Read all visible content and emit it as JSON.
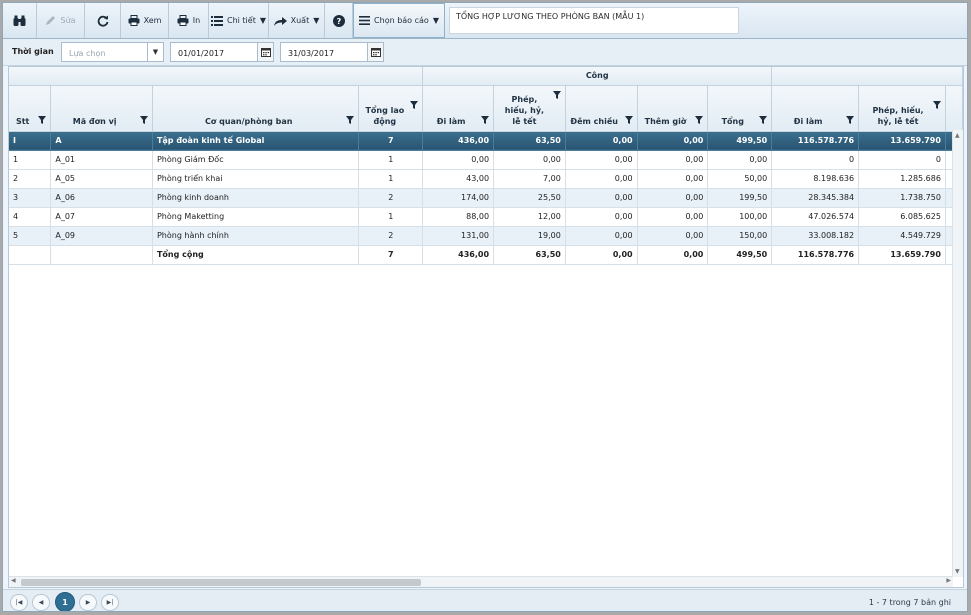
{
  "toolbar": {
    "edit_label": "Sửa",
    "view_label": "Xem",
    "print_label": "In",
    "detail_label": "Chi tiết",
    "export_label": "Xuất",
    "choose_report_label": "Chọn báo cáo",
    "report_title": "TỔNG HỢP LƯƠNG THEO PHÒNG BAN (MẪU 1)"
  },
  "filter": {
    "label": "Thời gian",
    "period_placeholder": "Lựa chọn",
    "from_date": "01/01/2017",
    "to_date": "31/03/2017"
  },
  "table": {
    "group_cong": "Công",
    "group_luong": "",
    "headers": {
      "stt": "Stt",
      "ma_don_vi": "Mã đơn vị",
      "co_quan": "Cơ quan/phòng ban",
      "tong_lao_dong": "Tổng lao động",
      "di_lam": "Đi làm",
      "phep": "Phép, hiếu, hỷ, lễ tết",
      "dem_chieu": "Đêm chiều",
      "them_gio": "Thêm giờ",
      "tong": "Tổng",
      "luong_di_lam": "Đi làm",
      "luong_phep": "Phép, hiếu, hỷ, lễ tết"
    },
    "rows": [
      {
        "stt": "I",
        "ma": "A",
        "ten": "Tập đoàn kinh tế Global",
        "tld": "7",
        "dilam": "436,00",
        "phep": "63,50",
        "dem": "0,00",
        "them": "0,00",
        "tong": "499,50",
        "l_dilam": "116.578.776",
        "l_phep": "13.659.790",
        "kind": "sel"
      },
      {
        "stt": "1",
        "ma": "A_01",
        "ten": "Phòng Giám Đốc",
        "tld": "1",
        "dilam": "0,00",
        "phep": "0,00",
        "dem": "0,00",
        "them": "0,00",
        "tong": "0,00",
        "l_dilam": "0",
        "l_phep": "0",
        "kind": ""
      },
      {
        "stt": "2",
        "ma": "A_05",
        "ten": "Phòng triển khai",
        "tld": "1",
        "dilam": "43,00",
        "phep": "7,00",
        "dem": "0,00",
        "them": "0,00",
        "tong": "50,00",
        "l_dilam": "8.198.636",
        "l_phep": "1.285.686",
        "kind": ""
      },
      {
        "stt": "3",
        "ma": "A_06",
        "ten": "Phòng kinh doanh",
        "tld": "2",
        "dilam": "174,00",
        "phep": "25,50",
        "dem": "0,00",
        "them": "0,00",
        "tong": "199,50",
        "l_dilam": "28.345.384",
        "l_phep": "1.738.750",
        "kind": "alt"
      },
      {
        "stt": "4",
        "ma": "A_07",
        "ten": "Phòng Maketting",
        "tld": "1",
        "dilam": "88,00",
        "phep": "12,00",
        "dem": "0,00",
        "them": "0,00",
        "tong": "100,00",
        "l_dilam": "47.026.574",
        "l_phep": "6.085.625",
        "kind": ""
      },
      {
        "stt": "5",
        "ma": "A_09",
        "ten": "Phòng hành chính",
        "tld": "2",
        "dilam": "131,00",
        "phep": "19,00",
        "dem": "0,00",
        "them": "0,00",
        "tong": "150,00",
        "l_dilam": "33.008.182",
        "l_phep": "4.549.729",
        "kind": "alt"
      },
      {
        "stt": "",
        "ma": "",
        "ten": "Tổng cộng",
        "tld": "7",
        "dilam": "436,00",
        "phep": "63,50",
        "dem": "0,00",
        "them": "0,00",
        "tong": "499,50",
        "l_dilam": "116.578.776",
        "l_phep": "13.659.790",
        "kind": "total"
      }
    ]
  },
  "pager": {
    "current_page": "1",
    "info": "1 - 7 trong 7 bản ghi"
  },
  "colors": {
    "selected_row": "#2f5f7e",
    "accent": "#2f6f93"
  }
}
